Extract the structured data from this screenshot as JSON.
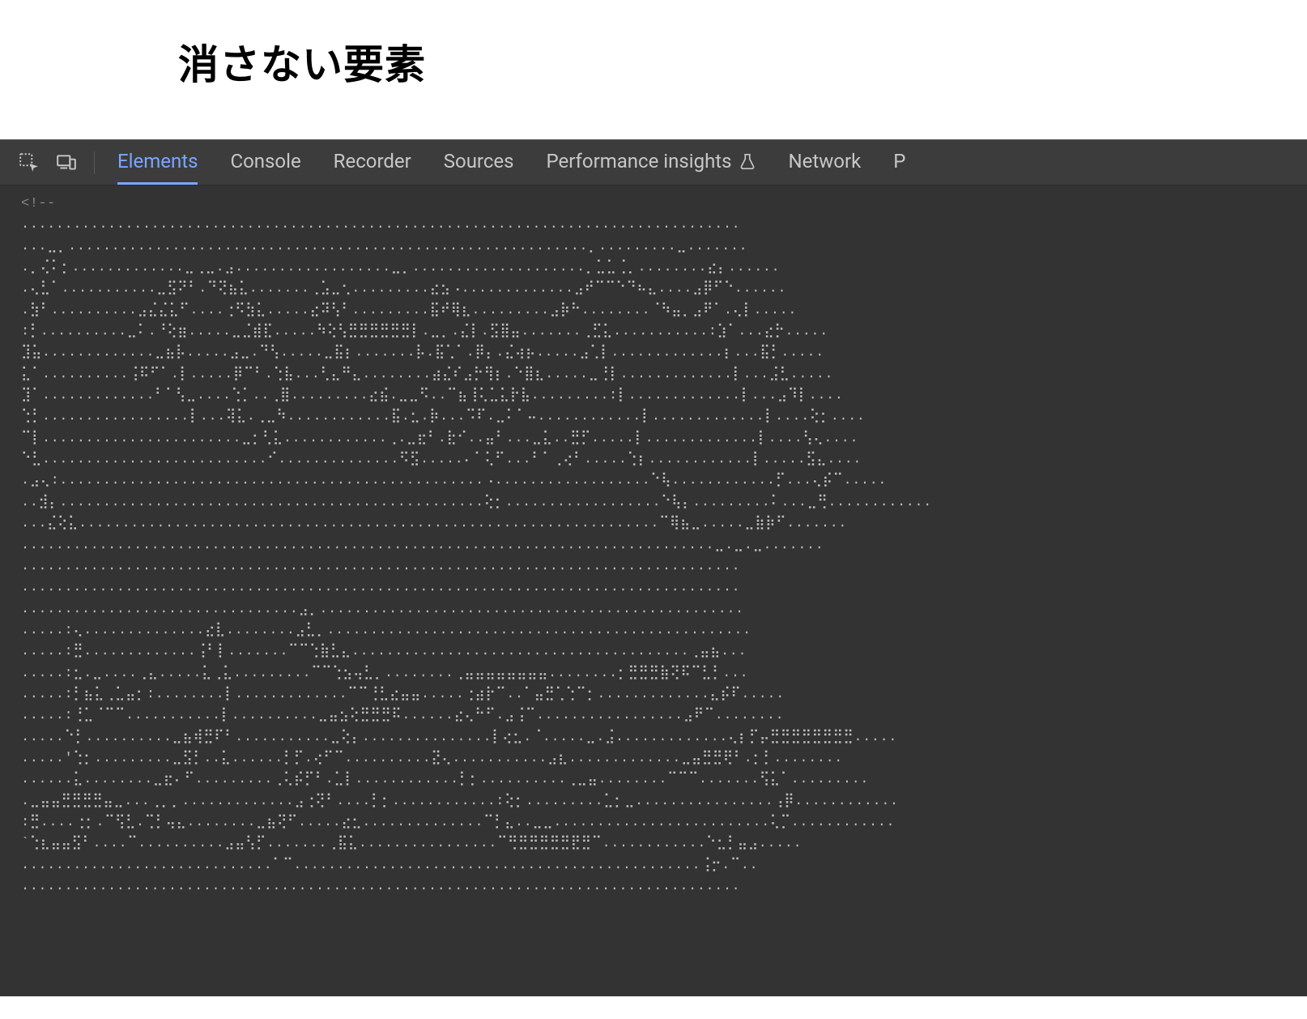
{
  "header": {
    "title": "消さない要素"
  },
  "devtools": {
    "tabs": [
      {
        "label": "Elements",
        "active": true
      },
      {
        "label": "Console",
        "active": false
      },
      {
        "label": "Recorder",
        "active": false
      },
      {
        "label": "Sources",
        "active": false
      },
      {
        "label": "Performance insights",
        "active": false,
        "experimental": true
      },
      {
        "label": "Network",
        "active": false
      },
      {
        "label": "P",
        "active": false
      }
    ],
    "source": {
      "comment_open": "<!--",
      "ascii_lines": [
        "...................................................................................",
        "...⣀⡀............................................................⡀.........⣀.......",
        ".⡀⢌⠅⡂.............⣀⢀⣀.⣠..................⣀⡀....................⡀⣁⣁⢈⡀........⣔⡄......",
        ".⢄⣃⠁...........⣀⣫⠝⠃.⠙⢝⣦⣅.......⢀⣡⣀⢂.........⣔⣢⠠.............⣠⠞⠉⠉⠑⠙⠦⣄....⣠⡿⠋⠑......",
        ".⣳⠃..........⣠⣌⣌⣅⠋....⢐⠫⣳⣅.....⣔⠽⢣⠃.........⣯⠞⢿⣆.........⣠⡷⠓........⠈⠳⣤⡀⣠⠟⠁.⢄⡇.....",
        ":⡃..........⣀⠅.⠘⢕⣶.....⣀⣈⣾⣏.....⠳⢕⢣⣛⣛⣛⣛⣛⣛⡇.⣀⡀.⣌⡇.⣫⣿⣤.......⢀⣋⣅...........:⣱⠁...⣔⡓.....",
        "⣹⣥.............⣀⣦⡧.....⣠⣀.⠙⢣.....⣀⣯⡆.......⡧.⣯⢁⠁.⡿⡄.⣌⢴⡦.....⣠⢁⡇.............⡆...⣯⡃.....",
        "⣅⠁..........⢨⠯⠋⠁.⡇.....⡿⠉⠃.⢑⣧...⢃⣄⠛⣄........⣴⣌⠎⣠⡓⢻⡆.⠑⣿⣆.....⣀⢘⡇.............⡇...⣨⣃.....",
        "⣹⠁.............⠃⠁⢣⣀....⢑⡁..⢀⣿.........⣔⣮.⣀⣀⠫..⠉⣦⢸⢅⣁⣅⡗⣧.........:⡇.............⡇...⣠⠹⡇....",
        "⢑⡃.................⡇...⢽⣅.⢀⣀⠳............⣯.⣂.⡷...⠩⠏.⣀⠅⠁⠤............⡇.............⡇....⢕⡂....",
        "⠉⡇.......................⣀⡂⢃⣅............⢀.⣀⣖⠃.⣗⠊..⣤⠃...⣀⣅..⣛⡋.....⡇.............⡇....⢣⢄....",
        "⠑⣃..........................⠊..............⠫⣫.....⠄⠁⢅⠋...⠃⠁⢀⢔⠃.....⢑⡆............⡇.....⣫⣄....",
        ".⣠⢄:.................................................⠠..................⠑⢧............⡋...⢄⡮⠉.....",
        "..⣺⡄.................................................⢕⡂..................⠑⢧⡄.........⠅...⣀⢛............",
        "...⣌⢕⣅...................................................................⠉⢿⣦⣀.....⣀⣷⡷⠋.......",
        "................................................................................⣀.⣀.⣀.......",
        "...................................................................................",
        "...................................................................................",
        "................................⣠⡀.................................................",
        ".....:⢄..............⣔⣇........⣠⣃⡀.................................................",
        ".....:⣛.............⢨⠃⡇.......⠉⠉⢑⣷⣃⣄.......................................⢀⣤⣦...",
        ".....:⣂.⣀....⢀⣄.....⣅⢀⣅.........⠉⠉⢑⣢⢤⣃⡀........⢀⣤⣤⣤⣤⣤⣤⣤⣤........⡂⣛⣛⣛⣷⢝⠯⠉⣃⡃...",
        ".....:⡃⣦⣅⢀⣁⣤⡂:........⡇.............⠉⠉⢘⣃⣔⣤⣤.....⢐⣴⡗⠉..⠁⣤⣛⢁⢑⠉⡂.............⣄⡮⠏.....",
        ".....:⢘⣁⠈⠉⠉...........⡇..........⣀⣤⣢⢕⣛⣛⣛⠯......⣔⢄⠓⠋.⣠⢨⠉.................⣠⠟⠉........",
        ".....⠑⡃..........⣀⣦⢾⣛⠏⠃...........⣀⢕⡄...............⡇⢔⣂.⠈.....⣀.⣨.............⢄⡆⡋⡤⣛⣛⣛⣛⣛⣛⣛⣛.....",
        ".....'⢑⡂.........⣀⣫⡃..⣅......⡃⡋.⢔⠋⠉..........⣝⢄...........⣠⣆.............⣀⣤⣛⣛⢟⠃.⡂⡃........",
        "......⣅........⣀⣖⠄⠋.........⢀⢅⡮⡋⠃.⣁⡇............⡃⡂..........⢀⣀⣤........⠉⠉⠉.......⢫⣅⠁.........",
        ".⣀⣤⣤⣛⣛⣛⣛⣤⣀...⢀⡀⡀.............⣠⢐⢝⠃....⡃⡂............:⢕⡂.........⣁⡂⣀................⢠⡿............",
        ":⣛....⢐⡂.⠉⢫⣃.⢉⡃⢤⣄........⣀⣦⢝⠋.....⣔⣂..............⠉⡃⣄..⣀⣀.........................⢅⡉............",
        "`⢑⣆⣤⣤⣫⠃....⠉..........⣠⣤⢣⡋.......⢀⣯⣅................⠉⢛⣛⣛⣛⣛⣛⣟⣛⠉............⠑⣂⡃⣤⣠.....",
        ".............................⠁⠉...............................................⢨⡒.⠉..",
        "..................................................................................."
      ]
    }
  }
}
